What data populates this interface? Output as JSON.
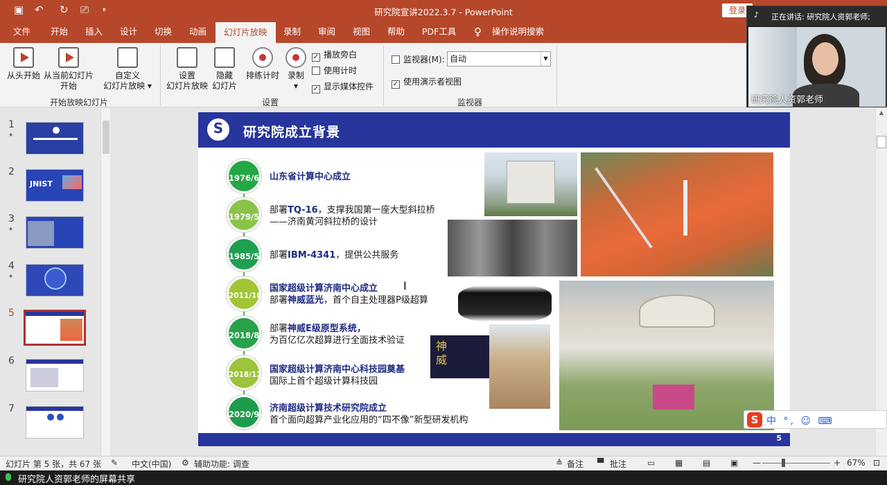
{
  "titlebar": {
    "title": "研究院宣讲2022.3.7 - PowerPoint",
    "login": "登录"
  },
  "tabs": [
    "文件",
    "开始",
    "插入",
    "设计",
    "切换",
    "动画",
    "幻灯片放映",
    "录制",
    "审阅",
    "视图",
    "帮助",
    "PDF工具",
    "操作说明搜索"
  ],
  "ribbon": {
    "from_beginning": "从头开始",
    "from_current_1": "从当前幻灯片",
    "from_current_2": "开始",
    "custom_1": "自定义",
    "custom_2": "幻灯片放映",
    "group_start": "开始放映幻灯片",
    "setup_1": "设置",
    "setup_2": "幻灯片放映",
    "hide_1": "隐藏",
    "hide_2": "幻灯片",
    "rehearse": "排练计时",
    "record": "录制",
    "play_narrations": "播放旁白",
    "use_timings": "使用计时",
    "show_media_controls": "显示媒体控件",
    "group_setup": "设置",
    "monitor_label": "监视器(M):",
    "monitor_value": "自动",
    "presenter_view": "使用演示者视图",
    "group_monitors": "监视器"
  },
  "thumbnails": [
    {
      "num": "1",
      "star": true
    },
    {
      "num": "2",
      "star": false,
      "text": "JNIST"
    },
    {
      "num": "3",
      "star": true
    },
    {
      "num": "4",
      "star": true
    },
    {
      "num": "5",
      "star": false
    },
    {
      "num": "6",
      "star": false
    },
    {
      "num": "7",
      "star": false
    }
  ],
  "slide": {
    "title": "研究院成立背景",
    "page_number": "5",
    "events": [
      {
        "date": "1976/6",
        "bold": "山东省计算中心成立",
        "text": ""
      },
      {
        "date": "1979/5",
        "pre": "部署",
        "bold": "TQ-16",
        "text": "，支撑我国第一座大型斜拉桥——济南黄河斜拉桥的设计"
      },
      {
        "date": "1985/5",
        "pre": "部署",
        "bold": "IBM-4341",
        "text": "，提供公共服务"
      },
      {
        "date": "2011/10",
        "bold": "国家超级计算济南中心成立",
        "pre2": "部署",
        "bold2": "神威蓝光",
        "text": "，首个自主处理器P级超算"
      },
      {
        "date": "2018/8",
        "pre": "部署",
        "bold": "神威E级原型系统，",
        "text": "为百亿亿次超算进行全面技术验证"
      },
      {
        "date": "2018/12",
        "bold": "国家超级计算济南中心科技园奠基",
        "text": "国际上首个超级计算科技园"
      },
      {
        "date": "2020/9",
        "bold": "济南超级计算技术研究院成立",
        "text": "首个面向超算产业化应用的“四不像”新型研发机构"
      }
    ]
  },
  "statusbar": {
    "slide_info": "幻灯片 第 5 张，共 67 张",
    "language": "中文(中国)",
    "accessibility": "辅助功能: 调查",
    "notes": "备注",
    "comments": "批注",
    "zoom": "67%"
  },
  "share": {
    "label": "研究院人资郭老师的屏幕共享"
  },
  "video": {
    "speaking": "正在讲话: 研究院人资郭老师;",
    "name": "研究院人资郭老师"
  },
  "ime": {
    "label": "中 °, ☺ ⌨"
  }
}
